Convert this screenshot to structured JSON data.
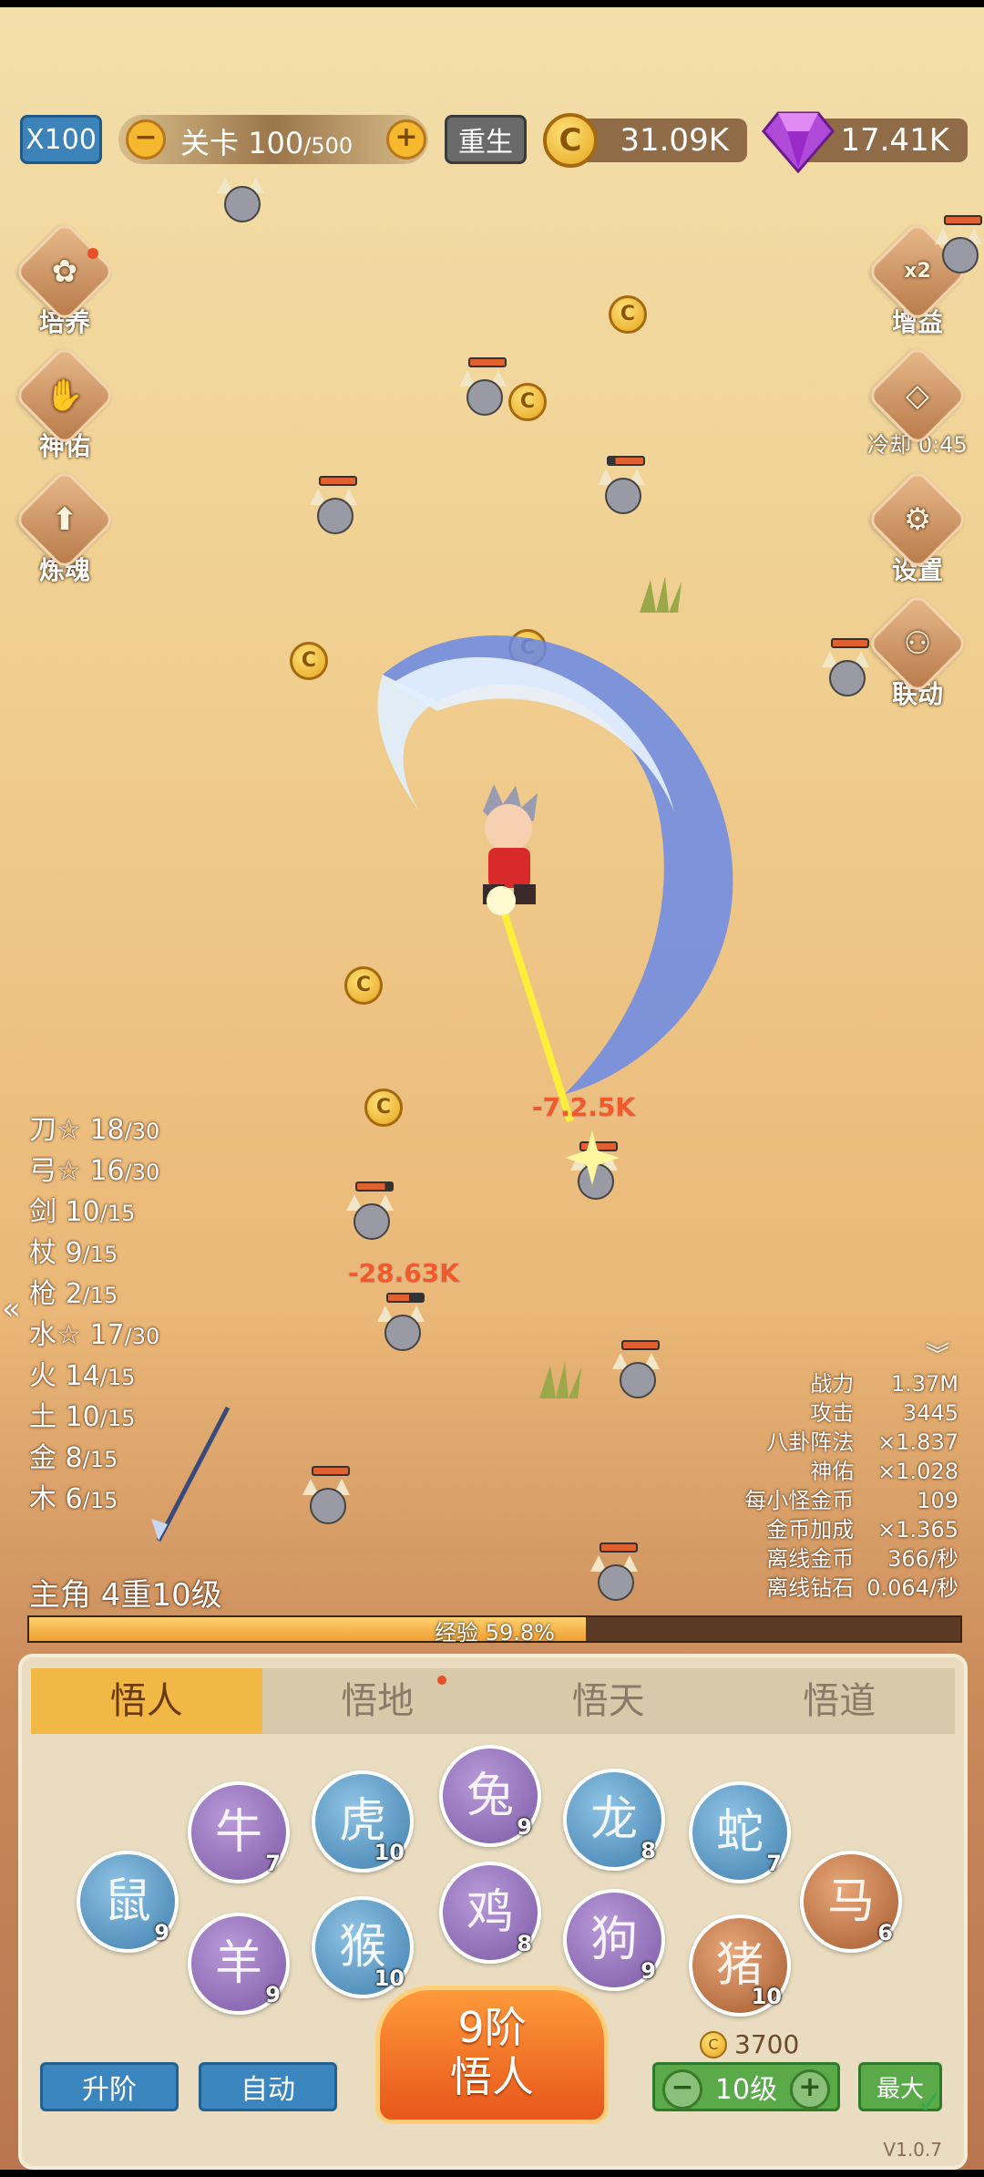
{
  "top_bar": {
    "speed_label": "X100",
    "stage_prefix": "关卡",
    "stage_current": "100",
    "stage_sep": "/",
    "stage_total": "500",
    "minus": "−",
    "plus": "+",
    "rebirth_label": "重生",
    "gold_value": "31.09K",
    "gem_value": "17.41K"
  },
  "left_menu": [
    {
      "label": "培养"
    },
    {
      "label": "神佑"
    },
    {
      "label": "炼魂"
    }
  ],
  "right_menu": [
    {
      "label": "增益",
      "badge": "x2"
    },
    {
      "label": "冷却 0:45"
    },
    {
      "label": "设置"
    },
    {
      "label": "联动"
    }
  ],
  "damage_texts": [
    "-7.2.5K",
    "-28.63K"
  ],
  "weapons": [
    {
      "name": "刀",
      "star": true,
      "cur": "18",
      "max": "/30"
    },
    {
      "name": "弓",
      "star": true,
      "cur": "16",
      "max": "/30"
    },
    {
      "name": "剑",
      "star": false,
      "cur": "10",
      "max": "/15"
    },
    {
      "name": "杖",
      "star": false,
      "cur": "9",
      "max": "/15"
    },
    {
      "name": "枪",
      "star": false,
      "cur": "2",
      "max": "/15"
    },
    {
      "name": "水",
      "star": true,
      "cur": "17",
      "max": "/30"
    },
    {
      "name": "火",
      "star": false,
      "cur": "14",
      "max": "/15"
    },
    {
      "name": "土",
      "star": false,
      "cur": "10",
      "max": "/15"
    },
    {
      "name": "金",
      "star": false,
      "cur": "8",
      "max": "/15"
    },
    {
      "name": "木",
      "star": false,
      "cur": "6",
      "max": "/15"
    }
  ],
  "stats": [
    {
      "label": "战力",
      "value": "1.37M"
    },
    {
      "label": "攻击",
      "value": "3445"
    },
    {
      "label": "八卦阵法",
      "value": "×1.837"
    },
    {
      "label": "神佑",
      "value": "×1.028"
    },
    {
      "label": "每小怪金币",
      "value": "109"
    },
    {
      "label": "金币加成",
      "value": "×1.365"
    },
    {
      "label": "离线金币",
      "value": "366/秒"
    },
    {
      "label": "离线钻石",
      "value": "0.064/秒"
    }
  ],
  "hero": {
    "level_text": "主角 4重10级",
    "exp_text": "经验 59.8%",
    "exp_progress": 0.598
  },
  "tabs": [
    {
      "label": "悟人",
      "active": true
    },
    {
      "label": "悟地",
      "active": false
    },
    {
      "label": "悟天",
      "active": false
    },
    {
      "label": "悟道",
      "active": false
    }
  ],
  "zodiac": [
    {
      "name": "rat",
      "glyph": "鼠",
      "level": "9",
      "tone": "blue"
    },
    {
      "name": "ox",
      "glyph": "牛",
      "level": "7",
      "tone": "purple"
    },
    {
      "name": "goat",
      "glyph": "羊",
      "level": "9",
      "tone": "purple"
    },
    {
      "name": "tiger",
      "glyph": "虎",
      "level": "10",
      "tone": "blue"
    },
    {
      "name": "monkey",
      "glyph": "猴",
      "level": "10",
      "tone": "blue"
    },
    {
      "name": "rabbit",
      "glyph": "兔",
      "level": "9",
      "tone": "purple"
    },
    {
      "name": "rooster",
      "glyph": "鸡",
      "level": "8",
      "tone": "purple"
    },
    {
      "name": "dragon",
      "glyph": "龙",
      "level": "8",
      "tone": "blue"
    },
    {
      "name": "dog",
      "glyph": "狗",
      "level": "9",
      "tone": "purple"
    },
    {
      "name": "snake",
      "glyph": "蛇",
      "level": "7",
      "tone": "blue"
    },
    {
      "name": "pig",
      "glyph": "猪",
      "level": "10",
      "tone": "brown"
    },
    {
      "name": "horse",
      "glyph": "马",
      "level": "6",
      "tone": "brown"
    }
  ],
  "bottom": {
    "upgrade_label": "升阶",
    "auto_label": "自动",
    "big_line1": "9阶",
    "big_line2": "悟人",
    "cost": "3700",
    "level_select": "10级",
    "max_label": "最大",
    "version": "V1.0.7"
  },
  "colors": {
    "accent": "#f1b846",
    "blue_button": "#3c86bf",
    "green_button": "#5aaa4a"
  }
}
